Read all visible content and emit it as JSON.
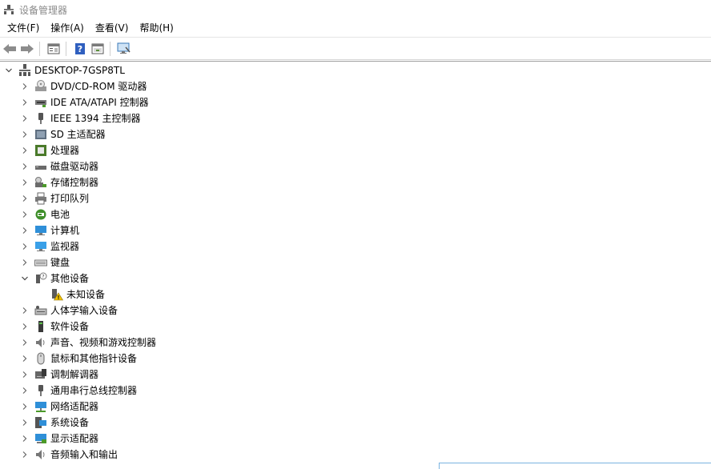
{
  "window": {
    "title": "设备管理器"
  },
  "menubar": [
    {
      "label": "文件(F)"
    },
    {
      "label": "操作(A)"
    },
    {
      "label": "查看(V)"
    },
    {
      "label": "帮助(H)"
    }
  ],
  "toolbar": {
    "buttons": [
      "back-arrow-icon",
      "forward-arrow-icon",
      "properties-icon",
      "help-icon",
      "view-icon",
      "scan-hardware-icon"
    ]
  },
  "tree": {
    "root": {
      "label": "DESKTOP-7GSP8TL",
      "expanded": true,
      "icon": "computer-icon"
    },
    "items": [
      {
        "label": "DVD/CD-ROM 驱动器",
        "icon": "dvd-drive-icon",
        "expanded": false
      },
      {
        "label": "IDE ATA/ATAPI 控制器",
        "icon": "ide-controller-icon",
        "expanded": false
      },
      {
        "label": "IEEE 1394 主控制器",
        "icon": "ieee1394-icon",
        "expanded": false
      },
      {
        "label": "SD 主适配器",
        "icon": "sd-adapter-icon",
        "expanded": false
      },
      {
        "label": "处理器",
        "icon": "processor-icon",
        "expanded": false
      },
      {
        "label": "磁盘驱动器",
        "icon": "disk-drive-icon",
        "expanded": false
      },
      {
        "label": "存储控制器",
        "icon": "storage-controller-icon",
        "expanded": false
      },
      {
        "label": "打印队列",
        "icon": "printer-icon",
        "expanded": false
      },
      {
        "label": "电池",
        "icon": "battery-icon",
        "expanded": false
      },
      {
        "label": "计算机",
        "icon": "computer-monitor-icon",
        "expanded": false
      },
      {
        "label": "监视器",
        "icon": "monitor-icon",
        "expanded": false
      },
      {
        "label": "键盘",
        "icon": "keyboard-icon",
        "expanded": false
      },
      {
        "label": "其他设备",
        "icon": "other-devices-icon",
        "expanded": true,
        "children": [
          {
            "label": "未知设备",
            "icon": "unknown-device-warning-icon"
          }
        ]
      },
      {
        "label": "人体学输入设备",
        "icon": "hid-icon",
        "expanded": false
      },
      {
        "label": "软件设备",
        "icon": "software-device-icon",
        "expanded": false
      },
      {
        "label": "声音、视频和游戏控制器",
        "icon": "sound-icon",
        "expanded": false
      },
      {
        "label": "鼠标和其他指针设备",
        "icon": "mouse-icon",
        "expanded": false
      },
      {
        "label": "调制解调器",
        "icon": "modem-icon",
        "expanded": false
      },
      {
        "label": "通用串行总线控制器",
        "icon": "usb-icon",
        "expanded": false
      },
      {
        "label": "网络适配器",
        "icon": "network-adapter-icon",
        "expanded": false
      },
      {
        "label": "系统设备",
        "icon": "system-devices-icon",
        "expanded": false
      },
      {
        "label": "显示适配器",
        "icon": "display-adapter-icon",
        "expanded": false
      },
      {
        "label": "音频输入和输出",
        "icon": "audio-io-icon",
        "expanded": false
      }
    ]
  }
}
